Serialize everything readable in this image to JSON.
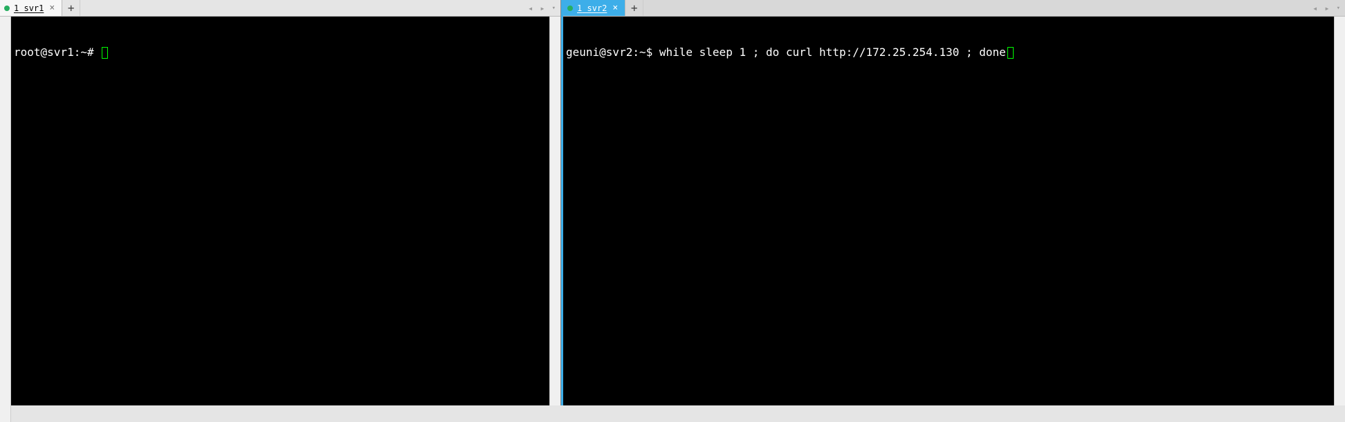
{
  "left": {
    "tab": {
      "index": "1",
      "title": "svr1",
      "active": true,
      "highlighted": false
    },
    "newTabGlyph": "+",
    "nav": {
      "left": "◂",
      "right": "▸",
      "down": "▾"
    },
    "prompt": "root@svr1:~# "
  },
  "right": {
    "tab": {
      "index": "1",
      "title": "svr2",
      "active": true,
      "highlighted": true
    },
    "newTabGlyph": "+",
    "nav": {
      "left": "◂",
      "right": "▸",
      "down": "▾"
    },
    "prompt": "geuni@svr2:~$ ",
    "command": "while sleep 1 ; do curl http://172.25.254.130 ; done"
  }
}
